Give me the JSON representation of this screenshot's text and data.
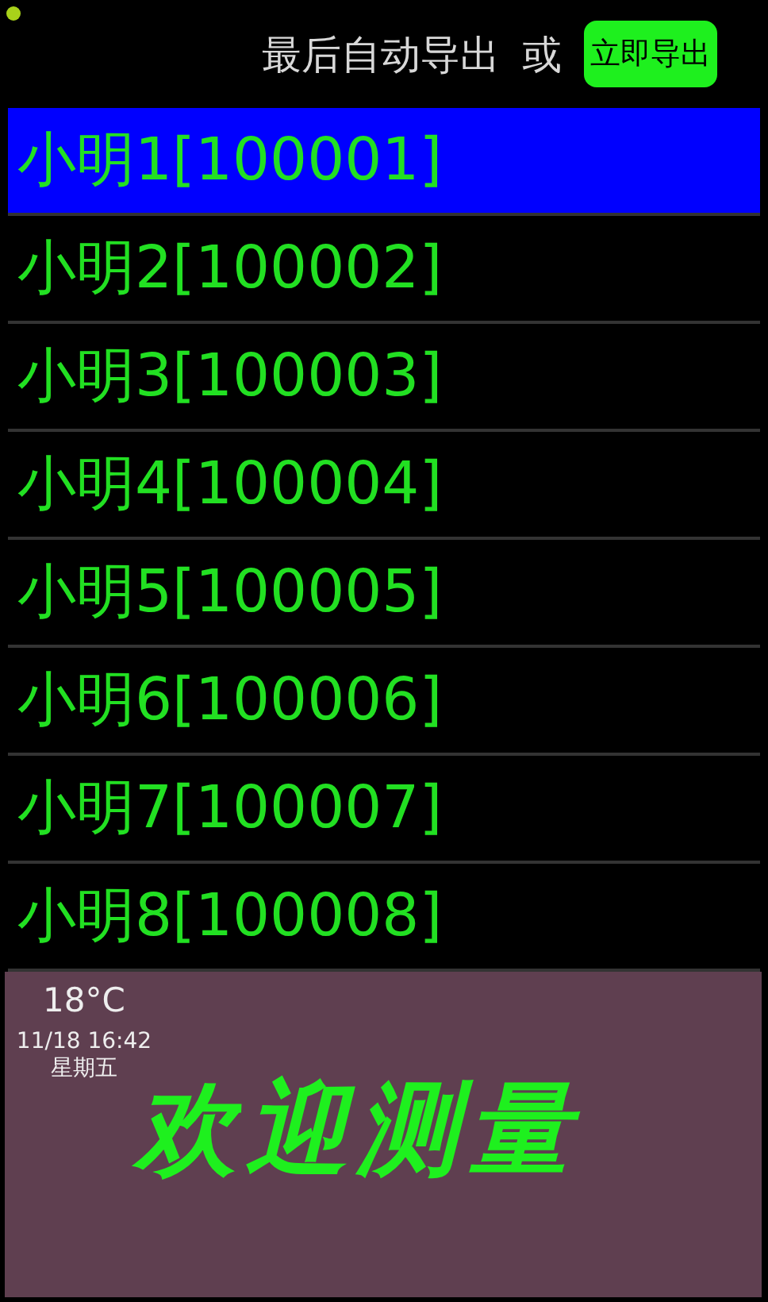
{
  "header": {
    "label": "最后自动导出",
    "separator": "或",
    "export_button": "立即导出"
  },
  "list": [
    {
      "label": "小明1[100001]",
      "selected": true
    },
    {
      "label": "小明2[100002]",
      "selected": false
    },
    {
      "label": "小明3[100003]",
      "selected": false
    },
    {
      "label": "小明4[100004]",
      "selected": false
    },
    {
      "label": "小明5[100005]",
      "selected": false
    },
    {
      "label": "小明6[100006]",
      "selected": false
    },
    {
      "label": "小明7[100007]",
      "selected": false
    },
    {
      "label": "小明8[100008]",
      "selected": false
    }
  ],
  "info": {
    "temperature": "18°C",
    "datetime": "11/18 16:42",
    "weekday": "星期五"
  },
  "banner": "欢迎测量"
}
